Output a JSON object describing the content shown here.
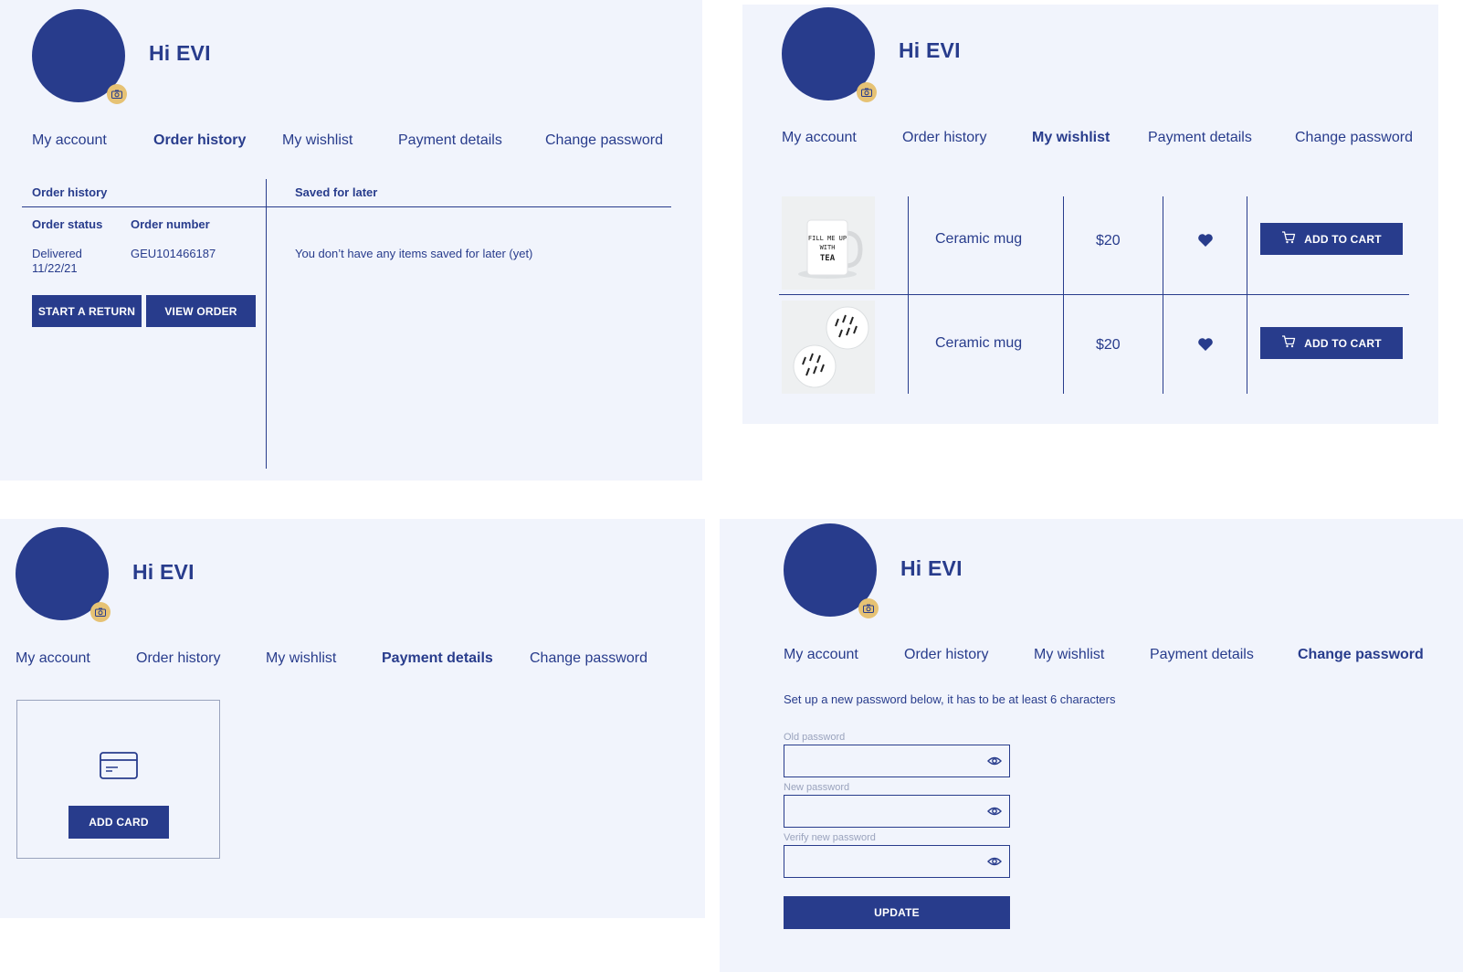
{
  "greeting": "Hi EVI",
  "tabs": [
    "My account",
    "Order history",
    "My wishlist",
    "Payment details",
    "Change password"
  ],
  "order_history": {
    "active_tab": "Order history",
    "section_title": "Order history",
    "saved_title": "Saved for later",
    "col_status": "Order status",
    "col_number": "Order number",
    "status_line1": "Delivered",
    "status_line2": "11/22/21",
    "order_number": "GEU101466187",
    "btn_return": "START A RETURN",
    "btn_view": "VIEW ORDER",
    "empty_saved": "You don’t have any items saved for later (yet)"
  },
  "wishlist": {
    "active_tab": "My wishlist",
    "items": [
      {
        "name": "Ceramic mug",
        "price": "$20",
        "cart_label": "ADD TO CART",
        "mug_text": "FILL ME UP WITH TEA"
      },
      {
        "name": "Ceramic mug",
        "price": "$20",
        "cart_label": "ADD TO CART"
      }
    ]
  },
  "payment": {
    "active_tab": "Payment details",
    "add_card_label": "ADD CARD"
  },
  "password": {
    "active_tab": "Change password",
    "instructions": "Set up a new password below, it has to be at least 6 characters",
    "old_label": "Old password",
    "new_label": "New password",
    "verify_label": "Verify new password",
    "update_label": "UPDATE"
  },
  "colors": {
    "navy": "#283c8c",
    "panel_bg": "#f1f4fc",
    "badge": "#e6c274"
  }
}
